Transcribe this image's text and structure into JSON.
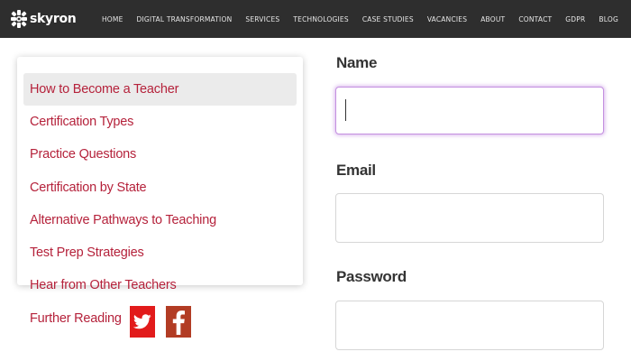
{
  "brand": {
    "name": "skyron"
  },
  "nav": {
    "items": [
      "HOME",
      "DIGITAL TRANSFORMATION",
      "SERVICES",
      "TECHNOLOGIES",
      "CASE STUDIES",
      "VACANCIES",
      "ABOUT",
      "CONTACT",
      "GDPR",
      "BLOG"
    ]
  },
  "sidebar": {
    "items": [
      {
        "label": "How to Become a Teacher",
        "active": true
      },
      {
        "label": "Certification Types"
      },
      {
        "label": "Practice Questions"
      },
      {
        "label": "Certification by State"
      },
      {
        "label": "Alternative Pathways to Teaching"
      },
      {
        "label": "Test Prep Strategies"
      },
      {
        "label": "Hear from Other Teachers"
      },
      {
        "label": "Further Reading"
      }
    ],
    "social": [
      {
        "icon": "twitter-icon",
        "color": "#e21b1b"
      },
      {
        "icon": "facebook-icon",
        "color": "#b23c24"
      }
    ]
  },
  "form": {
    "name": {
      "label": "Name",
      "value": "",
      "placeholder": ""
    },
    "email": {
      "label": "Email",
      "value": "",
      "placeholder": ""
    },
    "password": {
      "label": "Password",
      "value": "",
      "placeholder": ""
    }
  },
  "colors": {
    "topbar": "#2e2e2e",
    "link": "#b5223b",
    "focus": "#c490e0"
  }
}
